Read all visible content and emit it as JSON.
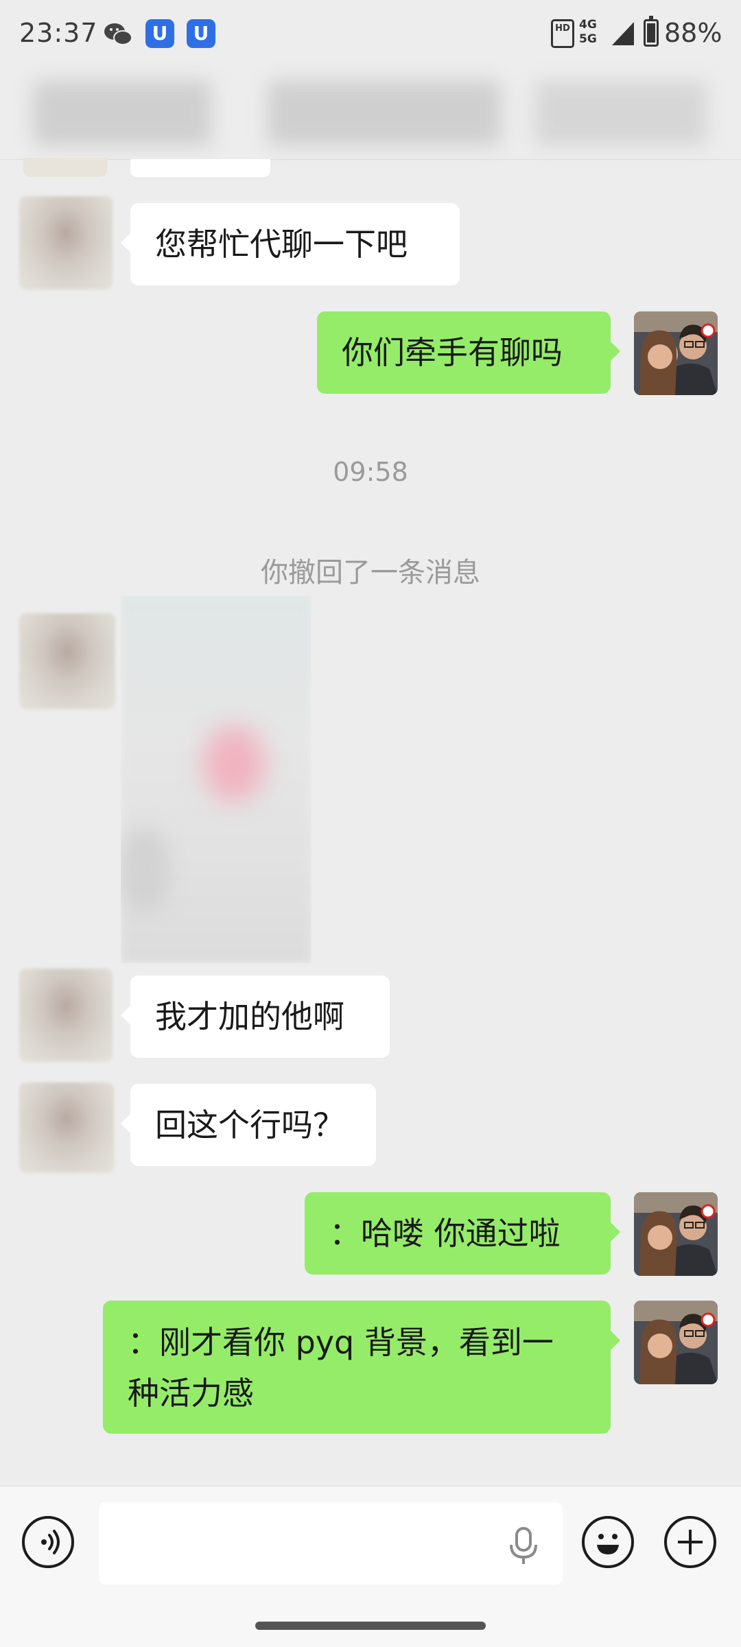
{
  "status_bar": {
    "time": "23:37",
    "badge_glyph": "U",
    "hd_label": "HD",
    "network": "4G\n5G",
    "battery": "88%",
    "icons": [
      "wechat-icon",
      "app-badge-icon",
      "hd-icon",
      "signal-icon",
      "battery-icon"
    ]
  },
  "messages": [
    {
      "side": "in",
      "text": "您帮忙代聊一下吧"
    },
    {
      "side": "out",
      "text": "你们牵手有聊吗"
    },
    {
      "side": "time",
      "text": "09:58"
    },
    {
      "side": "system",
      "text": "你撤回了一条消息"
    },
    {
      "side": "in",
      "type": "image"
    },
    {
      "side": "in",
      "text": "我才加的他啊"
    },
    {
      "side": "in",
      "text": "回这个行吗？"
    },
    {
      "side": "out",
      "text": "：哈喽 你通过啦"
    },
    {
      "side": "out",
      "text_line1": "：刚才看你 pyq 背景，看到一",
      "text_line2": "种活力感"
    }
  ],
  "input_bar": {
    "placeholder": "",
    "icons": [
      "voice-icon",
      "mic-icon",
      "emoji-icon",
      "plus-icon"
    ]
  },
  "colors": {
    "outgoing_bubble": "#95ec69",
    "incoming_bubble": "#ffffff",
    "background": "#ededed"
  }
}
